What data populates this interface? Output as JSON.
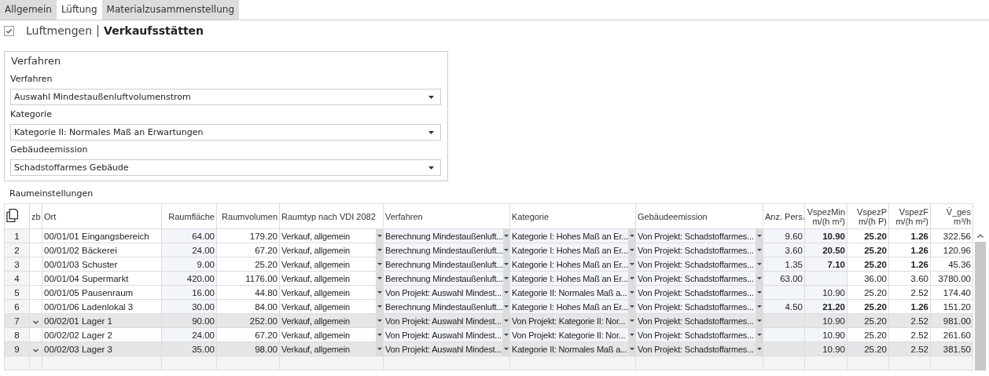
{
  "tabs": [
    {
      "label": "Allgemein",
      "selected": false
    },
    {
      "label": "Lüftung",
      "selected": true
    },
    {
      "label": "Materialzusammenstellung",
      "selected": false
    }
  ],
  "header": {
    "checked": true,
    "title": "Luftmengen",
    "subtitle": "Verkaufsstätten"
  },
  "group": {
    "title": "Verfahren",
    "fields": [
      {
        "label": "Verfahren",
        "value": "Auswahl Mindestaußenluftvolumenstrom"
      },
      {
        "label": "Kategorie",
        "value": "Kategorie II: Normales Maß an Erwartungen"
      },
      {
        "label": "Gebäudeemission",
        "value": "Schadstoffarmes Gebäude"
      }
    ]
  },
  "table": {
    "title": "Raumeinstellungen",
    "check_column": "zb",
    "columns": [
      {
        "label": "Ort",
        "kind": "text"
      },
      {
        "label": "Raumfläche",
        "kind": "number"
      },
      {
        "label": "Raumvolumen",
        "kind": "number"
      },
      {
        "label": "Raumtyp nach VDI 2082",
        "kind": "combo"
      },
      {
        "label": "Verfahren",
        "kind": "combo"
      },
      {
        "label": "Kategorie",
        "kind": "combo"
      },
      {
        "label": "Gebäudeemission",
        "kind": "combo"
      },
      {
        "label": "Anz. Pers.",
        "kind": "number"
      },
      {
        "label": "VspezMin",
        "unit": "m/(h m²)",
        "kind": "number"
      },
      {
        "label": "VspezP",
        "unit": "m/(h P)",
        "kind": "number"
      },
      {
        "label": "VspezF",
        "unit": "m/(h m²)",
        "kind": "number"
      },
      {
        "label": "V̇_ges",
        "unit": "m³/h",
        "kind": "number"
      }
    ],
    "rows": [
      {
        "nr": "1",
        "zb": false,
        "bold": true,
        "cells": [
          "00/01/01 Eingangsbereich",
          "64.00",
          "179.20",
          "Verkauf, allgemein",
          "Berechnung Mindestaußenluft...",
          "Kategorie I: Hohes Maß an Er...",
          "Von Projekt: Schadstoffarmes...",
          "9.60",
          "10.90",
          "25.20",
          "1.26",
          "322.56"
        ]
      },
      {
        "nr": "2",
        "zb": false,
        "bold": true,
        "cells": [
          "00/01/02 Bäckerei",
          "24.00",
          "67.20",
          "Verkauf, allgemein",
          "Berechnung Mindestaußenluft...",
          "Kategorie I: Hohes Maß an Er...",
          "Von Projekt: Schadstoffarmes...",
          "3.60",
          "20.50",
          "25.20",
          "1.26",
          "120.96"
        ]
      },
      {
        "nr": "3",
        "zb": false,
        "bold": true,
        "cells": [
          "00/01/03 Schuster",
          "9.00",
          "25.20",
          "Verkauf, allgemein",
          "Berechnung Mindestaußenluft...",
          "Kategorie I: Hohes Maß an Er...",
          "Von Projekt: Schadstoffarmes...",
          "1.35",
          "7.10",
          "25.20",
          "1.26",
          "45.36"
        ]
      },
      {
        "nr": "4",
        "zb": false,
        "bold": false,
        "cells": [
          "00/01/04 Supermarkt",
          "420.00",
          "1176.00",
          "Verkauf, allgemein",
          "Berechnung Mindestaußenluft...",
          "Kategorie I: Hohes Maß an Er...",
          "Von Projekt: Schadstoffarmes...",
          "63.00",
          "",
          "36.00",
          "3.60",
          "3780.00"
        ]
      },
      {
        "nr": "5",
        "zb": false,
        "bold": false,
        "cells": [
          "00/01/05 Pausenraum",
          "16.00",
          "44.80",
          "Verkauf, allgemein",
          "Von Projekt: Auswahl Mindest...",
          "Kategorie II: Normales Maß a...",
          "Von Projekt: Schadstoffarmes...",
          "",
          "10.90",
          "25.20",
          "2.52",
          "174.40"
        ]
      },
      {
        "nr": "6",
        "zb": false,
        "bold": true,
        "cells": [
          "00/01/06 Ladenlokal 3",
          "30.00",
          "84.00",
          "Verkauf, allgemein",
          "Berechnung Mindestaußenluft...",
          "Kategorie I: Hohes Maß an Er...",
          "Von Projekt: Schadstoffarmes...",
          "4.50",
          "21.20",
          "25.20",
          "1.26",
          "151.20"
        ]
      },
      {
        "nr": "7",
        "zb": true,
        "bold": false,
        "cells": [
          "00/02/01 Lager 1",
          "90.00",
          "252.00",
          "Verkauf, allgemein",
          "Von Projekt: Auswahl Mindest...",
          "Von Projekt: Kategorie II: Nor...",
          "Von Projekt: Schadstoffarmes...",
          "",
          "10.90",
          "25.20",
          "2.52",
          "981.00"
        ]
      },
      {
        "nr": "8",
        "zb": false,
        "bold": false,
        "cells": [
          "00/02/02 Lager 2",
          "24.00",
          "67.20",
          "Verkauf, allgemein",
          "Von Projekt: Auswahl Mindest...",
          "Von Projekt: Kategorie II: Nor...",
          "Von Projekt: Schadstoffarmes...",
          "",
          "10.90",
          "25.20",
          "2.52",
          "261.60"
        ]
      },
      {
        "nr": "9",
        "zb": true,
        "bold": false,
        "cells": [
          "00/02/03 Lager 3",
          "35.00",
          "98.00",
          "Verkauf, allgemein",
          "Von Projekt: Auswahl Mindest...",
          "Kategorie II: Normales Maß a...",
          "Von Projekt: Schadstoffarmes...",
          "",
          "10.90",
          "25.20",
          "2.52",
          "381.50"
        ]
      }
    ]
  }
}
